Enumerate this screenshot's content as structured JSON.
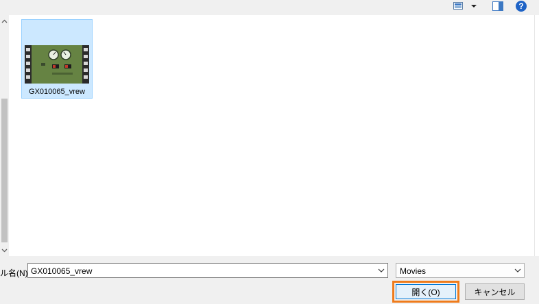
{
  "toolbar": {
    "view_icon": "view-options-icon",
    "view_dropdown_icon": "chevron-down-icon",
    "preview_icon": "preview-pane-icon",
    "help_label": "?"
  },
  "files": [
    {
      "name": "GX010065_vrew",
      "icon": "video-file-icon"
    }
  ],
  "bottom": {
    "filename_label": "ル名(N):",
    "filename_value": "GX010065_vrew",
    "filter_value": "Movies",
    "open_label": "開く(O)",
    "cancel_label": "キャンセル"
  },
  "colors": {
    "selection_bg": "#cce8ff",
    "selection_border": "#99d1ff",
    "highlight_frame": "#ef7b1b",
    "primary_button_border": "#0078d7"
  }
}
